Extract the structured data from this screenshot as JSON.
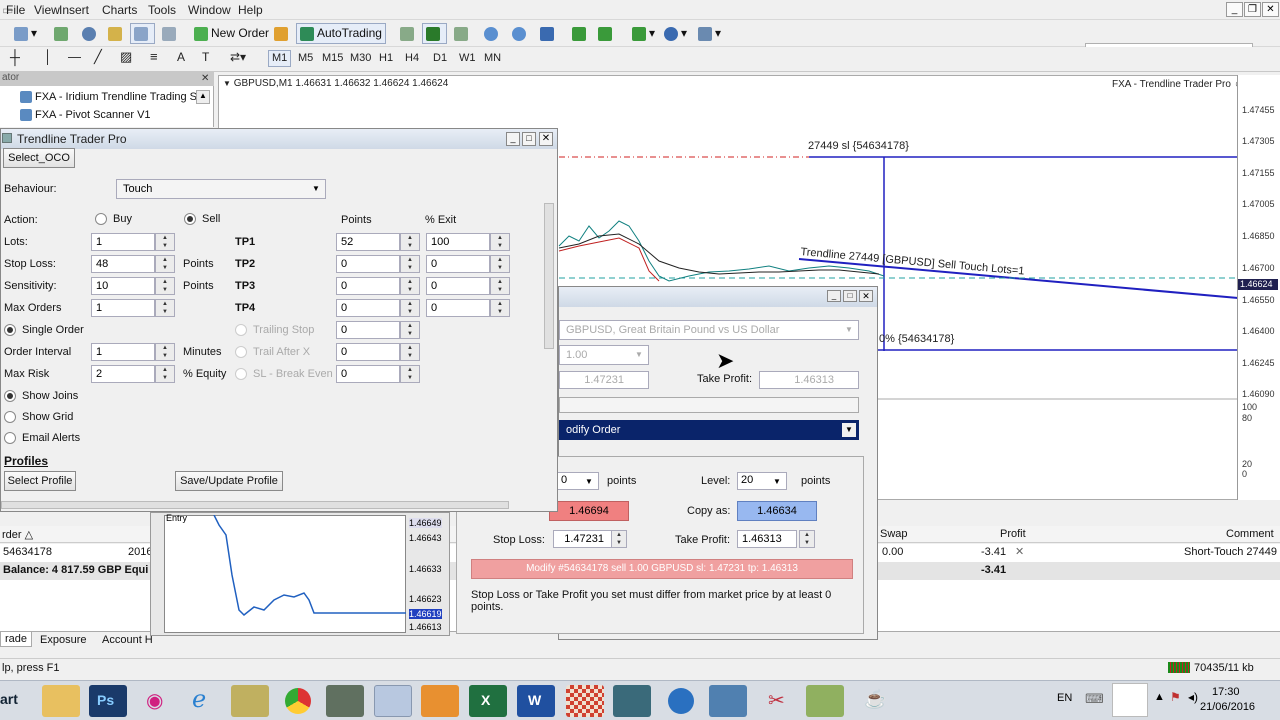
{
  "menu": {
    "items": [
      "File",
      "View",
      "Insert",
      "Charts",
      "Tools",
      "Window",
      "Help"
    ]
  },
  "toolbar": {
    "new_order": "New Order",
    "autotrading": "AutoTrading"
  },
  "timeframes": [
    "M1",
    "M5",
    "M15",
    "M30",
    "H1",
    "H4",
    "D1",
    "W1",
    "MN"
  ],
  "navigator": {
    "header": "ator",
    "items": [
      "FXA - Iridium Trendline Trading Sys",
      "FXA - Pivot Scanner V1"
    ]
  },
  "chart": {
    "symbol_info": "GBPUSD,M1  1.46631 1.46632 1.46624 1.46624",
    "ea_label": "FXA - Trendline Trader Pro",
    "sl_label": "27449 sl {54634178}",
    "trendline_label": "Trendline 27449 [GBPUSD] Sell Touch Lots=1",
    "tp_label": "0% {54634178}",
    "current_price": "1.46624",
    "price_axis": [
      "1.47455",
      "1.47305",
      "1.47155",
      "1.47005",
      "1.46850",
      "1.46700",
      "1.46550",
      "1.46400",
      "1.46245",
      "1.46090"
    ],
    "indicator_axis": [
      "100",
      "80",
      "20",
      "0"
    ]
  },
  "trendline_trader": {
    "title": "Trendline Trader Pro",
    "select_oco": "Select_OCO",
    "behaviour_label": "Behaviour:",
    "behaviour_value": "Touch",
    "action_label": "Action:",
    "buy_label": "Buy",
    "sell_label": "Sell",
    "points_header": "Points",
    "exit_header": "% Exit",
    "lots_label": "Lots:",
    "lots_value": "1",
    "stop_loss_label": "Stop Loss:",
    "stop_loss_value": "48",
    "points_unit": "Points",
    "sensitivity_label": "Sensitivity:",
    "sensitivity_value": "10",
    "max_orders_label": "Max Orders",
    "max_orders_value": "1",
    "single_order_label": "Single Order",
    "order_interval_label": "Order Interval",
    "order_interval_value": "1",
    "minutes_unit": "Minutes",
    "max_risk_label": "Max Risk",
    "max_risk_value": "2",
    "equity_unit": "% Equity",
    "show_joins": "Show Joins",
    "show_grid": "Show Grid",
    "email_alerts": "Email Alerts",
    "profiles_heading": "Profiles",
    "select_profile": "Select Profile",
    "save_profile": "Save/Update Profile",
    "tp": [
      {
        "label": "TP1",
        "points": "52",
        "exit": "100"
      },
      {
        "label": "TP2",
        "points": "0",
        "exit": "0"
      },
      {
        "label": "TP3",
        "points": "0",
        "exit": "0"
      },
      {
        "label": "TP4",
        "points": "0",
        "exit": "0"
      }
    ],
    "trailing_stop_label": "Trailing Stop",
    "trailing_stop_value": "0",
    "trail_after_label": "Trail After X",
    "trail_after_value": "0",
    "breakeven_label": "SL - Break Even",
    "breakeven_value": "0"
  },
  "modify_order": {
    "symbol": "GBPUSD, Great Britain Pound vs US Dollar",
    "volume": "1.00",
    "stop_loss_field": "1.47231",
    "take_profit_label": "Take Profit:",
    "take_profit_field": "1.46313",
    "type_value": "odify Order",
    "points_value": "0",
    "points_unit": "points",
    "level_label": "Level:",
    "level_value": "20",
    "level_unit": "points",
    "sell_price": "1.46694",
    "copy_as_label": "Copy as:",
    "copy_as_value": "1.46634",
    "sl_label": "Stop Loss:",
    "sl_value": "1.47231",
    "tp_label": "Take Profit:",
    "tp_value": "1.46313",
    "modify_button": "Modify #54634178 sell 1.00 GBPUSD sl: 1.47231 tp: 1.46313",
    "note": "Stop Loss or Take Profit you set must differ from market price by at least 0 points."
  },
  "mini_chart": {
    "entry_label": "Entry",
    "axis": [
      "1.46649",
      "1.46643",
      "1.46633",
      "1.46623",
      "1.46619",
      "1.46613"
    ]
  },
  "terminal": {
    "col_order": "rder",
    "col_swap": "Swap",
    "col_profit": "Profit",
    "col_comment": "Comment",
    "order_id": "54634178",
    "order_time": "2016",
    "swap": "0.00",
    "profit": "-3.41",
    "comment": "Short-Touch 27449",
    "balance": "Balance: 4 817.59 GBP  Equi",
    "balance_profit": "-3.41",
    "tabs": [
      "rade",
      "Exposure",
      "Account H"
    ]
  },
  "status": {
    "help": "lp, press F1",
    "traffic": "70435/11 kb"
  },
  "taskbar": {
    "start": "art",
    "lang": "EN",
    "time": "17:30",
    "date": "21/06/2016"
  }
}
